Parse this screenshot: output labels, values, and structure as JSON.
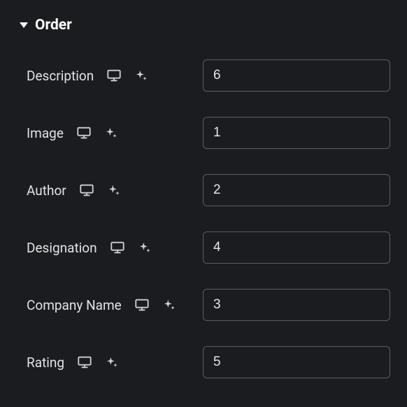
{
  "section": {
    "title": "Order"
  },
  "fields": [
    {
      "id": "description",
      "label": "Description",
      "value": "6"
    },
    {
      "id": "image",
      "label": "Image",
      "value": "1"
    },
    {
      "id": "author",
      "label": "Author",
      "value": "2"
    },
    {
      "id": "designation",
      "label": "Designation",
      "value": "4"
    },
    {
      "id": "company-name",
      "label": "Company Name",
      "value": "3"
    },
    {
      "id": "rating",
      "label": "Rating",
      "value": "5"
    }
  ],
  "icons": {
    "monitor": "monitor-icon",
    "sparkle": "sparkle-icon"
  }
}
